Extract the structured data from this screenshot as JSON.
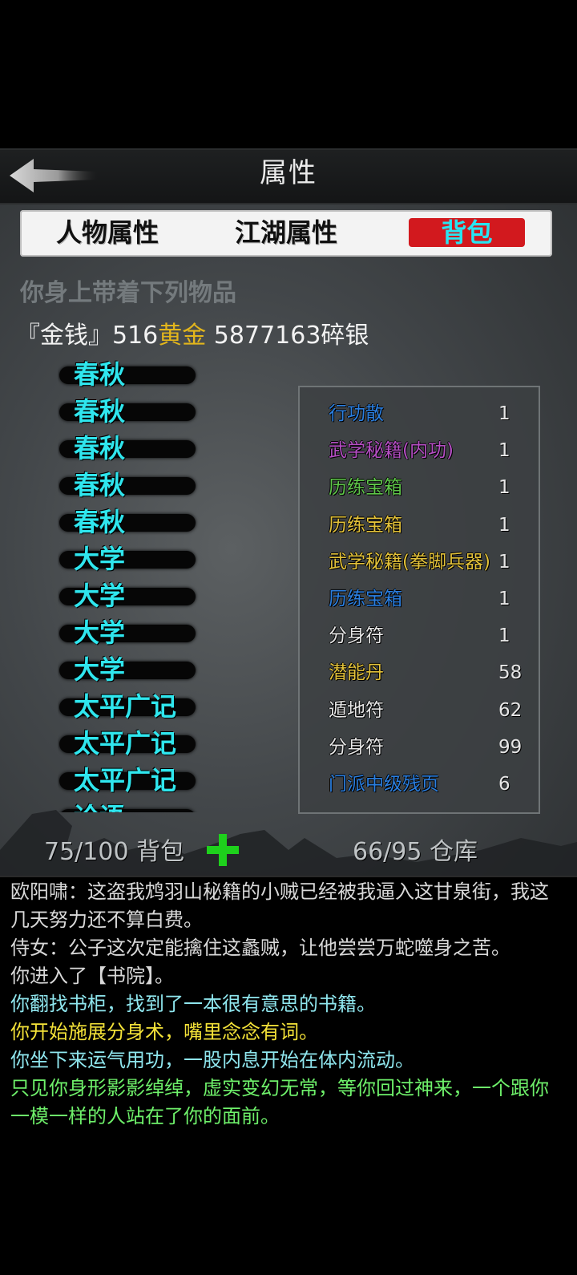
{
  "header": {
    "title": "属性"
  },
  "tabs": [
    {
      "label": "人物属性"
    },
    {
      "label": "江湖属性"
    },
    {
      "label": "背包",
      "active": true
    }
  ],
  "inventory": {
    "subtitle": "你身上带着下列物品",
    "money": {
      "prefix": "『金钱』516",
      "gold_label": "黄金",
      "silver": " 5877163碎银"
    },
    "books": [
      {
        "label": "春秋"
      },
      {
        "label": "春秋"
      },
      {
        "label": "春秋"
      },
      {
        "label": "春秋"
      },
      {
        "label": "春秋"
      },
      {
        "label": "大学"
      },
      {
        "label": "大学"
      },
      {
        "label": "大学"
      },
      {
        "label": "大学"
      },
      {
        "label": "太平广记"
      },
      {
        "label": "太平广记"
      },
      {
        "label": "太平广记"
      },
      {
        "label": "论语"
      }
    ],
    "items": [
      {
        "name": "行功散",
        "qty": "1",
        "color": "#2b7fe0"
      },
      {
        "name": "武学秘籍(内功)",
        "qty": "1",
        "color": "#b54fc4"
      },
      {
        "name": "历练宝箱",
        "qty": "1",
        "color": "#5fc64a"
      },
      {
        "name": "历练宝箱",
        "qty": "1",
        "color": "#e3c23a"
      },
      {
        "name": "武学秘籍(拳脚兵器)",
        "qty": "1",
        "color": "#e3c23a"
      },
      {
        "name": "历练宝箱",
        "qty": "1",
        "color": "#2b7fe0"
      },
      {
        "name": "分身符",
        "qty": "1",
        "color": "#e6e6e6"
      },
      {
        "name": "潜能丹",
        "qty": "58",
        "color": "#e3c23a"
      },
      {
        "name": "遁地符",
        "qty": "62",
        "color": "#e6e6e6"
      },
      {
        "name": "分身符",
        "qty": "99",
        "color": "#e6e6e6"
      },
      {
        "name": "门派中级残页",
        "qty": "6",
        "color": "#2b7fe0"
      }
    ],
    "bag_capacity": "75/100 背包",
    "storage_capacity": "66/95 仓库"
  },
  "log": [
    {
      "text": "欧阳啸：这盗我鸩羽山秘籍的小贼已经被我逼入这甘泉街，我这几天努力还不算白费。",
      "color": "#d8d8d8"
    },
    {
      "text": "侍女：公子这次定能擒住这蠡贼，让他尝尝万蛇噬身之苦。",
      "color": "#d8d8d8"
    },
    {
      "text": "你进入了【书院】。",
      "color": "#d8d8d8"
    },
    {
      "text": "你翻找书柜，找到了一本很有意思的书籍。",
      "color": "#8fe6ee"
    },
    {
      "text": "你开始施展分身术，嘴里念念有词。",
      "color": "#f4e238"
    },
    {
      "text": "你坐下来运气用功，一股内息开始在体内流动。",
      "color": "#8fe6ee"
    },
    {
      "text": "只见你身形影影绰绰，虚实变幻无常，等你回过神来，一个跟你一模一样的人站在了你的面前。",
      "color": "#6ef06a"
    }
  ],
  "icons": {
    "back": "arrow-left-icon",
    "add_bag": "plus-icon"
  }
}
